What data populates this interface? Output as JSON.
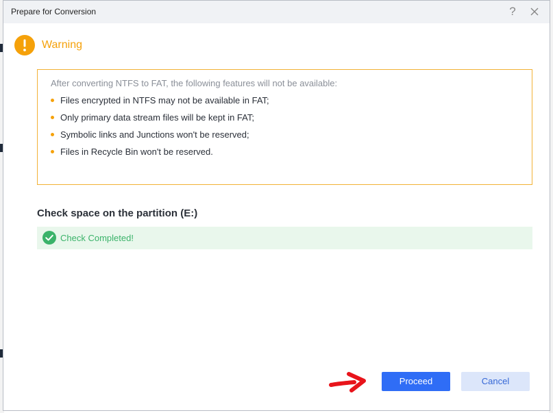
{
  "window": {
    "title": "Prepare for Conversion",
    "help_icon": "question-mark-icon",
    "help_glyph": "?",
    "close_icon": "close-icon"
  },
  "warning": {
    "icon": "warning-circle-icon",
    "title": "Warning",
    "intro": "After converting NTFS to FAT, the following features will not be available:",
    "items": [
      "Files encrypted in NTFS may not be available in FAT;",
      "Only primary data stream files will be kept in FAT;",
      "Symbolic links and Junctions won't be reserved;",
      "Files in Recycle Bin won't be reserved."
    ]
  },
  "check": {
    "title": "Check space on the partition (E:)",
    "status_icon": "check-circle-icon",
    "status_text": "Check Completed!"
  },
  "actions": {
    "proceed_label": "Proceed",
    "cancel_label": "Cancel"
  },
  "colors": {
    "accent": "#2f6df6",
    "warning": "#f5a10a",
    "success": "#3bb36a",
    "annotation_arrow": "#e8141b"
  }
}
